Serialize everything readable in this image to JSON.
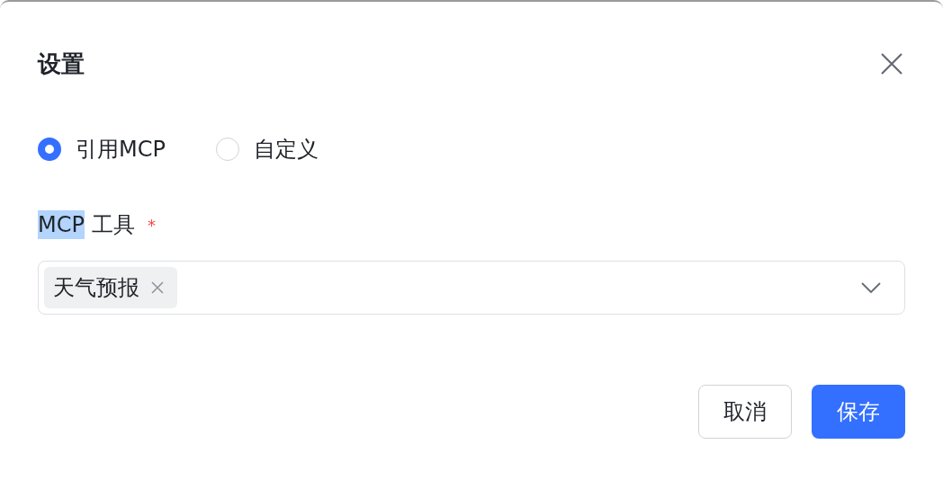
{
  "dialog": {
    "title": "设置"
  },
  "source_options": [
    {
      "label": "引用MCP",
      "selected": true
    },
    {
      "label": "自定义",
      "selected": false
    }
  ],
  "field": {
    "label_parts": [
      {
        "text": "MCP",
        "highlighted": true
      },
      {
        "text": "工具",
        "highlighted": false
      }
    ],
    "required": true,
    "required_mark": "*",
    "tags": [
      {
        "label": "天气预报"
      }
    ]
  },
  "buttons": [
    {
      "label": "取消",
      "kind": "secondary"
    },
    {
      "label": "保存",
      "kind": "primary"
    }
  ]
}
